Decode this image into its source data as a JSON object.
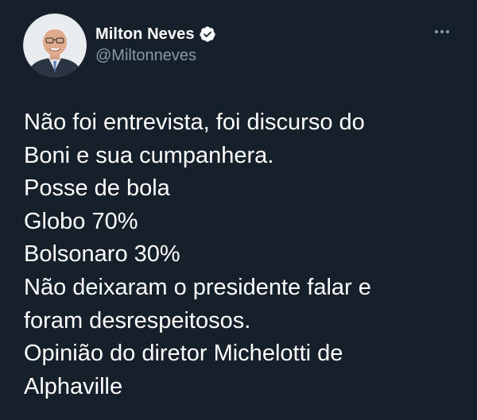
{
  "author": {
    "display_name": "Milton Neves",
    "handle": "@Miltonneves",
    "verified": true,
    "avatar_icon": "profile-photo"
  },
  "more_icon": "ellipsis-icon",
  "tweet": {
    "lines": [
      "Não foi entrevista, foi discurso do",
      "Boni e sua cumpanhera.",
      "Posse de bola",
      "Globo 70%",
      "Bolsonaro 30%",
      "Não deixaram o presidente falar e",
      "foram desrespeitosos.",
      "Opinião do diretor Michelotti de",
      "Alphaville"
    ]
  },
  "colors": {
    "background": "#15202b",
    "text": "#ffffff",
    "secondary": "#8899a6",
    "verified_badge": "#ffffff"
  }
}
